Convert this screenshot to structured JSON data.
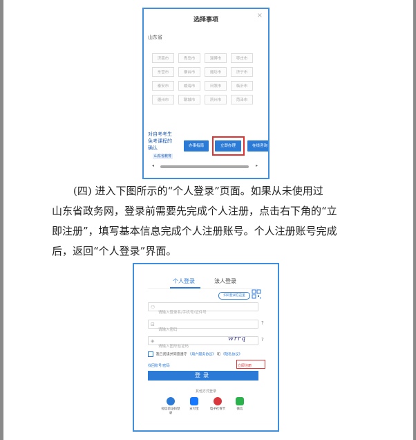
{
  "select_dialog": {
    "title": "选择事项",
    "close_glyph": "×",
    "province": "山东省",
    "cities": [
      "济南市",
      "青岛市",
      "淄博市",
      "枣庄市",
      "东营市",
      "烟台市",
      "潍坊市",
      "济宁市",
      "泰安市",
      "威海市",
      "日照市",
      "临沂市",
      "德州市",
      "聊城市",
      "滨州市",
      "菏泽市"
    ],
    "bottom_text": [
      "对自考考生",
      "免考课程的",
      "确认"
    ],
    "tag": "山东省教育",
    "buttons": [
      "办事指南",
      "立即办理",
      "在线咨询"
    ]
  },
  "paragraph": {
    "line1": "(四) 进入下图所示的“个人登录”页面。如果从未使用过",
    "line2": "山东省政务网，登录前需要先完成个人注册，点击右下角的“立",
    "line3": "即注册”，填写基本信息完成个人注册账号。个人注册账号完成",
    "line4": "后，返回“个人登录”界面。"
  },
  "login": {
    "tab_personal": "个人登录",
    "tab_legal": "法人登录",
    "qr_label": "扫码登录在这里",
    "username_placeholder": "请输入登录名/手机号/证件号",
    "password_placeholder": "请输入密码",
    "captcha_placeholder": "请输入图形验证码",
    "captcha_text": "wrrq",
    "help_glyph": "?",
    "agree_prefix": "我已阅读并同意遵守",
    "agree_link1": "《用户服务协议》",
    "agree_and": "和",
    "agree_link2": "《隐私协议》",
    "forgot": "找回账号/密码",
    "register": "立即注册",
    "login_button": "登录",
    "other_methods": "其他方式登录",
    "options": [
      {
        "label": "短信验证码登录",
        "color": "#2b7ad6"
      },
      {
        "label": "支付宝",
        "color": "#1677ff"
      },
      {
        "label": "电子社保卡",
        "color": "#d9363e"
      },
      {
        "label": "微信",
        "color": "#2bb24c"
      }
    ]
  }
}
